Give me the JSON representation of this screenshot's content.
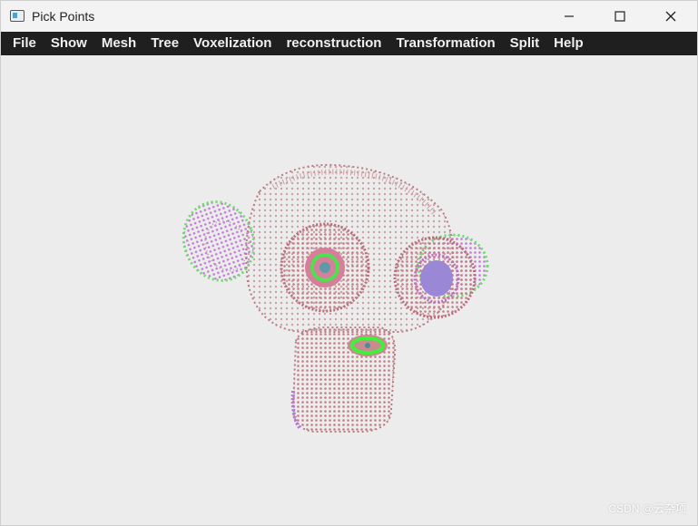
{
  "window": {
    "title": "Pick Points",
    "icon": "app-window-icon"
  },
  "controls": {
    "minimize": "minimize-icon",
    "maximize": "maximize-icon",
    "close": "close-icon"
  },
  "menu": {
    "items": [
      {
        "label": "File"
      },
      {
        "label": "Show"
      },
      {
        "label": "Mesh"
      },
      {
        "label": "Tree"
      },
      {
        "label": "Voxelization"
      },
      {
        "label": "reconstruction"
      },
      {
        "label": "Transformation"
      },
      {
        "label": "Split"
      },
      {
        "label": "Help"
      }
    ]
  },
  "viewport": {
    "background": "#ececec",
    "model": "monkey head point cloud",
    "colors": {
      "body": "#c98c8c",
      "accent_green": "#5cd65c",
      "accent_purple": "#b27ad6",
      "accent_blue": "#7a8fd6"
    }
  },
  "watermark": "CSDN @云杂项"
}
